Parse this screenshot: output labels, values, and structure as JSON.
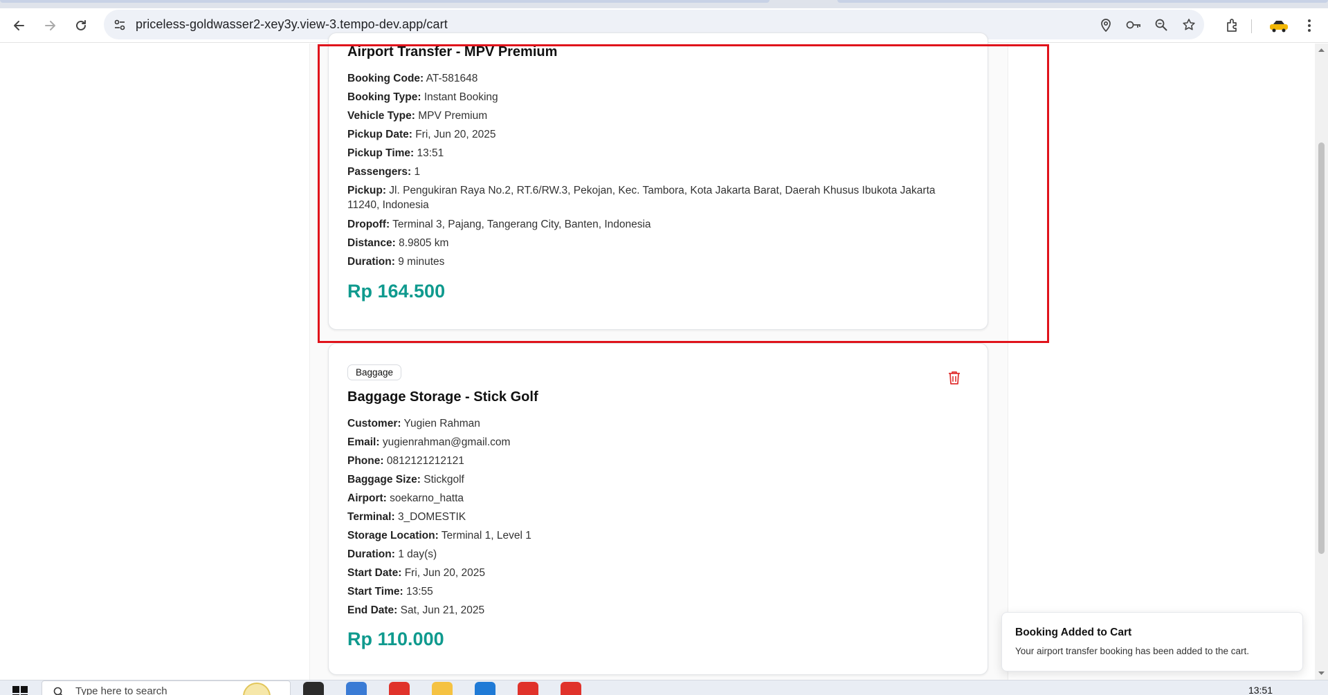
{
  "browser": {
    "url": "priceless-goldwasser2-xey3y.view-3.tempo-dev.app/cart"
  },
  "cart": {
    "items": [
      {
        "title": "Airport Transfer - MPV Premium",
        "fields": [
          {
            "label": "Booking Code:",
            "value": "AT-581648"
          },
          {
            "label": "Booking Type:",
            "value": "Instant Booking"
          },
          {
            "label": "Vehicle Type:",
            "value": "MPV Premium"
          },
          {
            "label": "Pickup Date:",
            "value": "Fri, Jun 20, 2025"
          },
          {
            "label": "Pickup Time:",
            "value": "13:51"
          },
          {
            "label": "Passengers:",
            "value": "1"
          },
          {
            "label": "Pickup:",
            "value": "Jl. Pengukiran Raya No.2, RT.6/RW.3, Pekojan, Kec. Tambora, Kota Jakarta Barat, Daerah Khusus Ibukota Jakarta 11240, Indonesia"
          },
          {
            "label": "Dropoff:",
            "value": "Terminal 3, Pajang, Tangerang City, Banten, Indonesia"
          },
          {
            "label": "Distance:",
            "value": "8.9805 km"
          },
          {
            "label": "Duration:",
            "value": "9 minutes"
          }
        ],
        "price": "Rp 164.500"
      },
      {
        "badge": "Baggage",
        "title": "Baggage Storage - Stick Golf",
        "fields": [
          {
            "label": "Customer:",
            "value": "Yugien Rahman"
          },
          {
            "label": "Email:",
            "value": "yugienrahman@gmail.com"
          },
          {
            "label": "Phone:",
            "value": "0812121212121"
          },
          {
            "label": "Baggage Size:",
            "value": "Stickgolf"
          },
          {
            "label": "Airport:",
            "value": "soekarno_hatta"
          },
          {
            "label": "Terminal:",
            "value": "3_DOMESTIK"
          },
          {
            "label": "Storage Location:",
            "value": "Terminal 1, Level 1"
          },
          {
            "label": "Duration:",
            "value": "1 day(s)"
          },
          {
            "label": "Start Date:",
            "value": "Fri, Jun 20, 2025"
          },
          {
            "label": "Start Time:",
            "value": "13:55"
          },
          {
            "label": "End Date:",
            "value": "Sat, Jun 21, 2025"
          }
        ],
        "price": "Rp 110.000"
      }
    ]
  },
  "toast": {
    "title": "Booking Added to Cart",
    "description": "Your airport transfer booking has been added to the cart."
  },
  "taskbar": {
    "search_text": "Type here to search",
    "clock": "13:51"
  },
  "colors": {
    "price": "#0f9a8e",
    "highlight": "#e0131b",
    "trash": "#e03131"
  },
  "icons": [
    "back-icon",
    "forward-icon",
    "reload-icon",
    "site-settings-icon",
    "location-icon",
    "key-icon",
    "zoom-icon",
    "star-icon",
    "extensions-icon",
    "profile-icon",
    "menu-icon",
    "trash-icon",
    "windows-icon",
    "search-icon"
  ]
}
